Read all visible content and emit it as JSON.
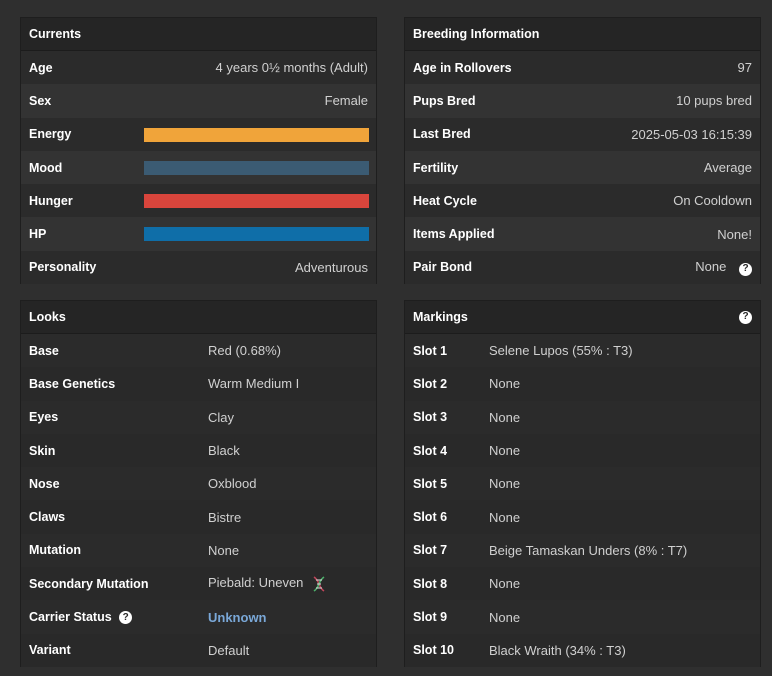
{
  "currents": {
    "title": "Currents",
    "age_label": "Age",
    "age_value": "4 years 0½ months (Adult)",
    "sex_label": "Sex",
    "sex_value": "Female",
    "energy_label": "Energy",
    "energy_color": "#f0a43a",
    "energy_level": 1.0,
    "mood_label": "Mood",
    "mood_color": "#3b5b73",
    "mood_level": 1.0,
    "hunger_label": "Hunger",
    "hunger_color": "#d9453c",
    "hunger_level": 1.0,
    "hp_label": "HP",
    "hp_color": "#0f6ea8",
    "hp_level": 1.0,
    "personality_label": "Personality",
    "personality_value": "Adventurous"
  },
  "breeding": {
    "title": "Breeding Information",
    "rollovers_label": "Age in Rollovers",
    "rollovers_value": "97",
    "pups_label": "Pups Bred",
    "pups_value": "10 pups bred",
    "last_label": "Last Bred",
    "last_value": "2025-05-03 16:15:39",
    "fertility_label": "Fertility",
    "fertility_value": "Average",
    "heat_label": "Heat Cycle",
    "heat_value": "On Cooldown",
    "items_label": "Items Applied",
    "items_value": "None!",
    "pair_label": "Pair Bond",
    "pair_value": "None",
    "help_glyph": "?"
  },
  "looks": {
    "title": "Looks",
    "rows": [
      {
        "label": "Base",
        "value": "Red (0.68%)"
      },
      {
        "label": "Base Genetics",
        "value": "Warm Medium I"
      },
      {
        "label": "Eyes",
        "value": "Clay"
      },
      {
        "label": "Skin",
        "value": "Black"
      },
      {
        "label": "Nose",
        "value": "Oxblood"
      },
      {
        "label": "Claws",
        "value": "Bistre"
      },
      {
        "label": "Mutation",
        "value": "None"
      },
      {
        "label": "Secondary Mutation",
        "value": "Piebald: Uneven"
      },
      {
        "label": "Carrier Status",
        "value": "Unknown"
      },
      {
        "label": "Variant",
        "value": "Default"
      }
    ]
  },
  "markings": {
    "title": "Markings",
    "rows": [
      {
        "label": "Slot 1",
        "value": "Selene Lupos (55% : T3)"
      },
      {
        "label": "Slot 2",
        "value": "None"
      },
      {
        "label": "Slot 3",
        "value": "None"
      },
      {
        "label": "Slot 4",
        "value": "None"
      },
      {
        "label": "Slot 5",
        "value": "None"
      },
      {
        "label": "Slot 6",
        "value": "None"
      },
      {
        "label": "Slot 7",
        "value": "Beige Tamaskan Unders (8% : T7)"
      },
      {
        "label": "Slot 8",
        "value": "None"
      },
      {
        "label": "Slot 9",
        "value": "None"
      },
      {
        "label": "Slot 10",
        "value": "Black Wraith (34% : T3)"
      }
    ]
  },
  "icons": {
    "help": "question-circle-icon",
    "dna": "dna-icon"
  }
}
